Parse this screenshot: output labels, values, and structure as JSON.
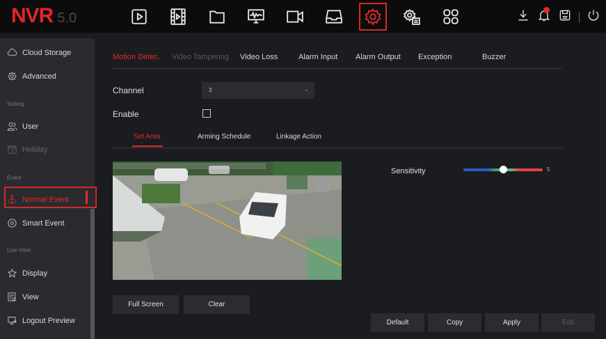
{
  "logo": {
    "brand": "NVR",
    "version": "5.0"
  },
  "nav": {
    "icons": [
      "playback-icon",
      "video-file-icon",
      "folder-icon",
      "network-monitor-icon",
      "camera-icon",
      "storage-tray-icon",
      "settings-gear-icon",
      "system-config-icon",
      "grid-icon"
    ],
    "active": "settings-gear-icon"
  },
  "topright": {
    "icons": [
      "download-icon",
      "alarm-bell-icon",
      "save-icon",
      "power-icon"
    ]
  },
  "sidebar": {
    "items": [
      {
        "label": "Cloud Storage",
        "icon": "cloud-icon"
      },
      {
        "label": "Advanced",
        "icon": "gear-badge-icon"
      },
      {
        "label": "User",
        "icon": "users-icon"
      },
      {
        "label": "Holiday",
        "icon": "calendar-icon"
      },
      {
        "label": "Normal Event",
        "icon": "anchor-icon"
      },
      {
        "label": "Smart Event",
        "icon": "target-icon"
      },
      {
        "label": "Display",
        "icon": "star-icon"
      },
      {
        "label": "View",
        "icon": "view-icon"
      },
      {
        "label": "Logout Preview",
        "icon": "logout-icon"
      }
    ],
    "sections": {
      "setting": "Setting",
      "event": "Event",
      "live_view": "Live View"
    }
  },
  "tabs": [
    "Motion Detec.",
    "Video Tampering",
    "Video Loss",
    "Alarm Input",
    "Alarm Output",
    "Exception",
    "Buzzer"
  ],
  "form": {
    "channel_label": "Channel",
    "channel_value": "3",
    "enable_label": "Enable"
  },
  "subtabs": [
    "Set Area",
    "Arming Schedule",
    "Linkage Action"
  ],
  "sensitivity": {
    "label": "Sensitivity",
    "value": "5",
    "level": 0.5
  },
  "buttons": {
    "full_screen": "Full Screen",
    "clear": "Clear",
    "default": "Default",
    "copy": "Copy",
    "apply": "Apply",
    "edit": "Edit"
  },
  "colors": {
    "accent": "#e32b2b",
    "background": "#1b1c1f",
    "sidebar": "#2a2b2e"
  }
}
